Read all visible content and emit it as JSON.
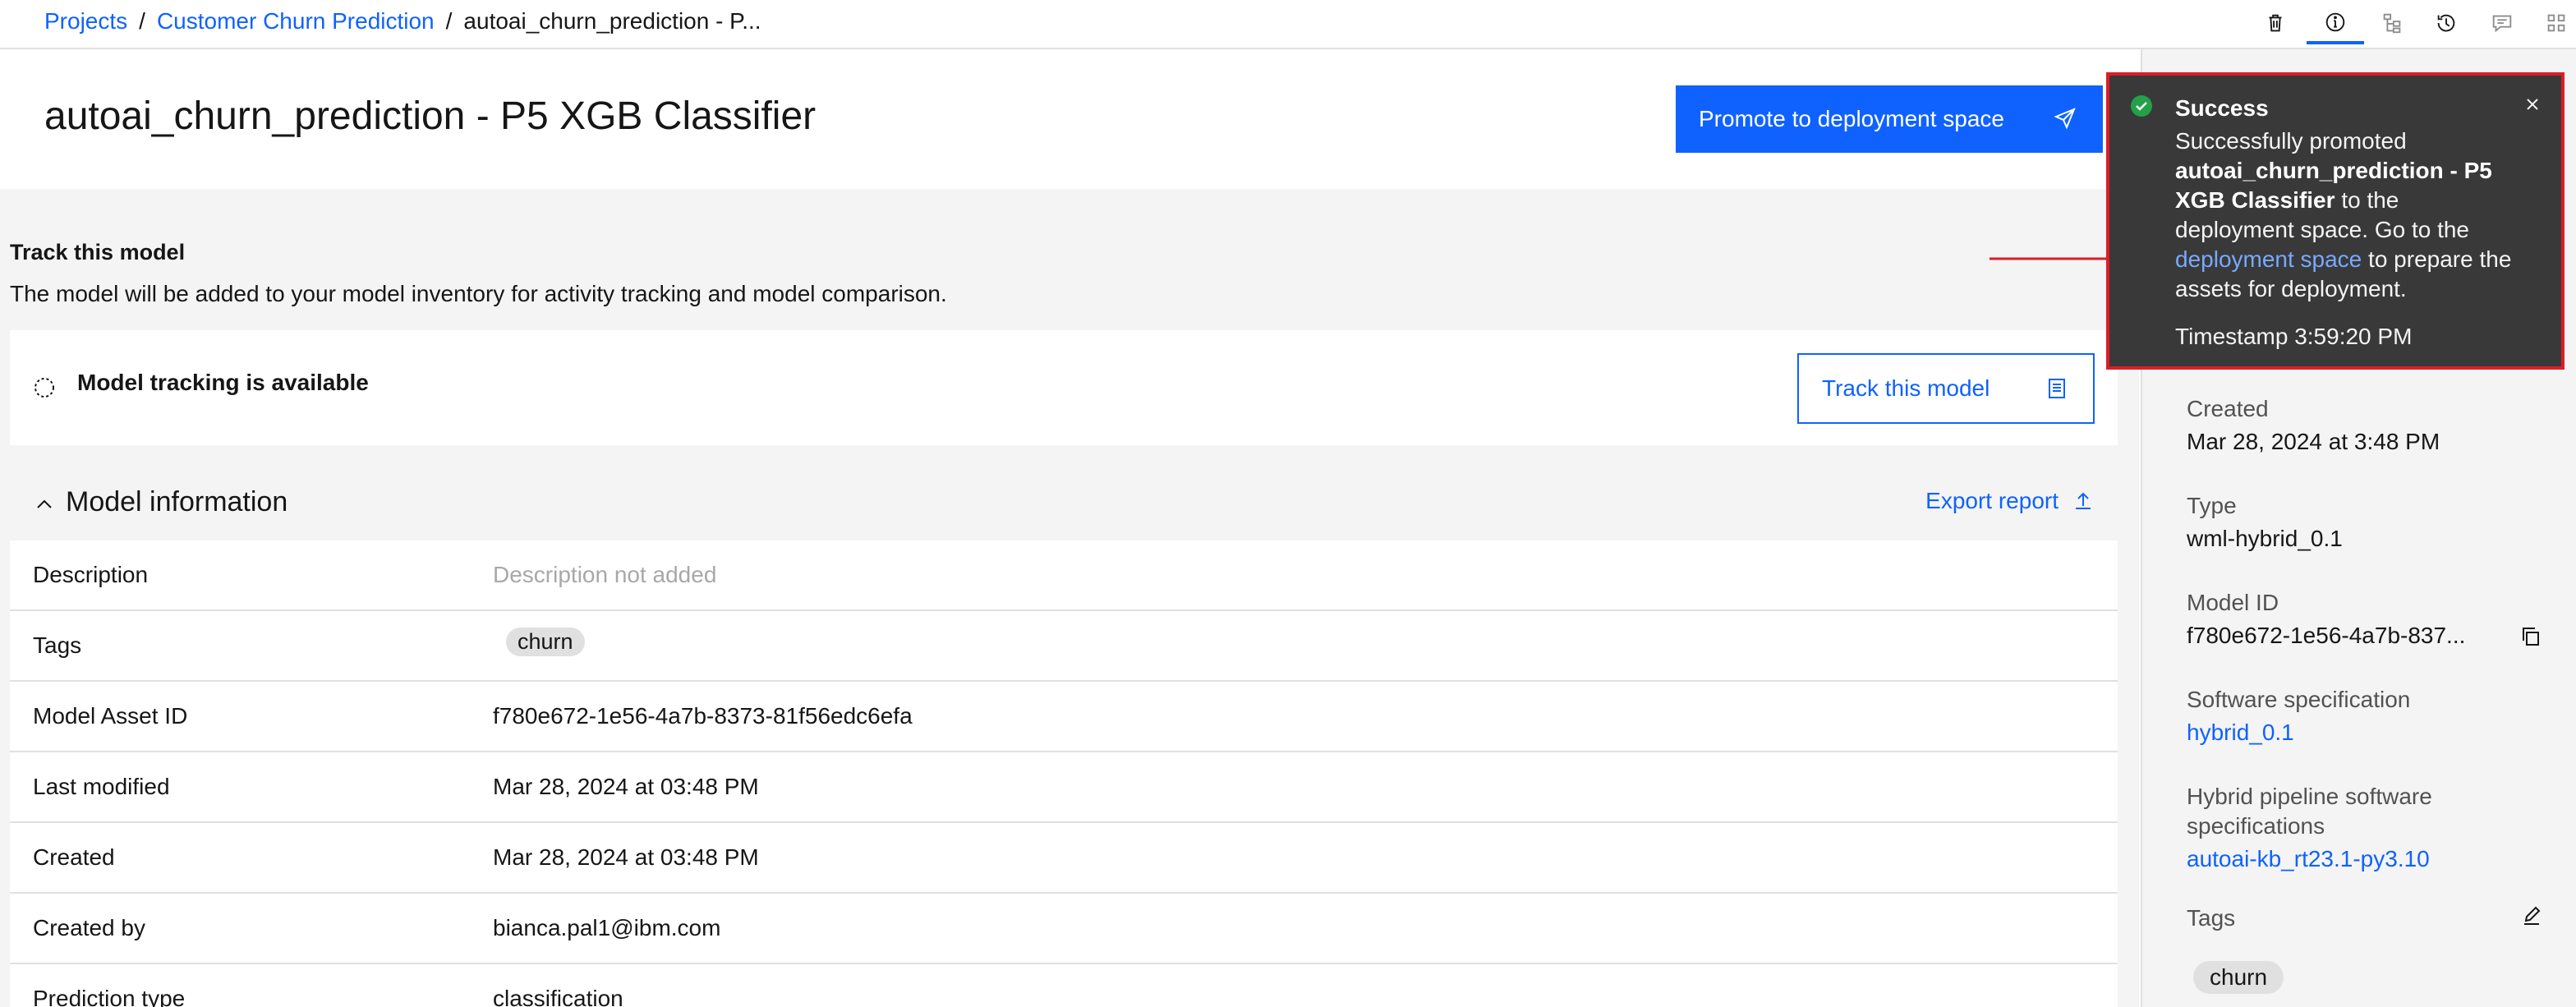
{
  "breadcrumb": {
    "projects": "Projects",
    "project": "Customer Churn Prediction",
    "current": "autoai_churn_prediction - P...",
    "sep1": "/",
    "sep2": "/"
  },
  "toolbar_icons": [
    "trash-icon",
    "info-icon",
    "lineage-icon",
    "history-icon",
    "comment-icon",
    "apps-icon"
  ],
  "header": {
    "title": "autoai_churn_prediction - P5 XGB Classifier",
    "promote_label": "Promote to deployment space"
  },
  "track": {
    "title": "Track this model",
    "description": "The model will be added to your model inventory for activity tracking and model comparison.",
    "status": "Model tracking is available",
    "button_label": "Track this model"
  },
  "model_info": {
    "title": "Model information",
    "export_label": "Export report",
    "rows": [
      {
        "key": "Description",
        "value": "Description not added"
      },
      {
        "key": "Tags",
        "value": "churn"
      },
      {
        "key": "Model Asset ID",
        "value": "f780e672-1e56-4a7b-8373-81f56edc6efa"
      },
      {
        "key": "Last modified",
        "value": "Mar 28, 2024 at 03:48 PM"
      },
      {
        "key": "Created",
        "value": "Mar 28, 2024 at 03:48 PM"
      },
      {
        "key": "Created by",
        "value": "bianca.pal1@ibm.com"
      },
      {
        "key": "Prediction type",
        "value": "classification"
      }
    ]
  },
  "side_panel": {
    "created_label": "Created",
    "created_value": "Mar 28, 2024 at 3:48 PM",
    "type_label": "Type",
    "type_value": "wml-hybrid_0.1",
    "model_id_label": "Model ID",
    "model_id_value": "f780e672-1e56-4a7b-837...",
    "software_spec_label": "Software specification",
    "software_spec_value": "hybrid_0.1",
    "hybrid_spec_label_1": "Hybrid pipeline software",
    "hybrid_spec_label_2": "specifications",
    "hybrid_spec_value": "autoai-kb_rt23.1-py3.10",
    "tags_label": "Tags",
    "tag_value": "churn"
  },
  "toast": {
    "title": "Success",
    "body_1": "Successfully promoted",
    "body_bold": "autoai_churn_prediction - P5 XGB Classifier",
    "body_2": "to the deployment space. Go to the",
    "link": "deployment space",
    "body_3": "to prepare the assets for deployment.",
    "timestamp": "Timestamp 3:59:20 PM"
  },
  "colors": {
    "primary": "#0f62fe",
    "toast_bg": "#393939",
    "success": "#24a148",
    "highlight": "#da1e28"
  }
}
